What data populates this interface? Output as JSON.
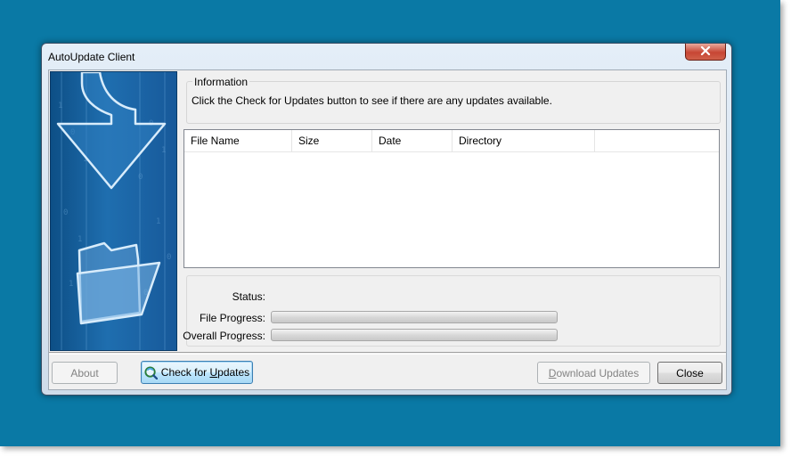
{
  "window": {
    "title": "AutoUpdate Client"
  },
  "information": {
    "group_label": "Information",
    "message": "Click the Check for Updates button to see if there are any updates available."
  },
  "file_list": {
    "columns": [
      "File Name",
      "Size",
      "Date",
      "Directory"
    ],
    "rows": []
  },
  "status": {
    "status_label": "Status:",
    "status_value": "",
    "file_progress_label": "File Progress:",
    "file_progress": 0,
    "overall_progress_label": "Overall Progress:",
    "overall_progress": 0
  },
  "buttons": {
    "about": "About",
    "check_pre": "Check for ",
    "check_ul": "U",
    "check_post": "pdates",
    "download_ul": "D",
    "download_post": "ownload Updates",
    "close": "Close"
  },
  "icons": {
    "close": "close-icon",
    "check": "check-updates-icon",
    "banner_arrow": "down-arrow-icon",
    "banner_folder": "folder-icon"
  },
  "colors": {
    "desktop": "#0a79a5",
    "banner": "#1f6eaf",
    "close_button": "#c74634"
  }
}
